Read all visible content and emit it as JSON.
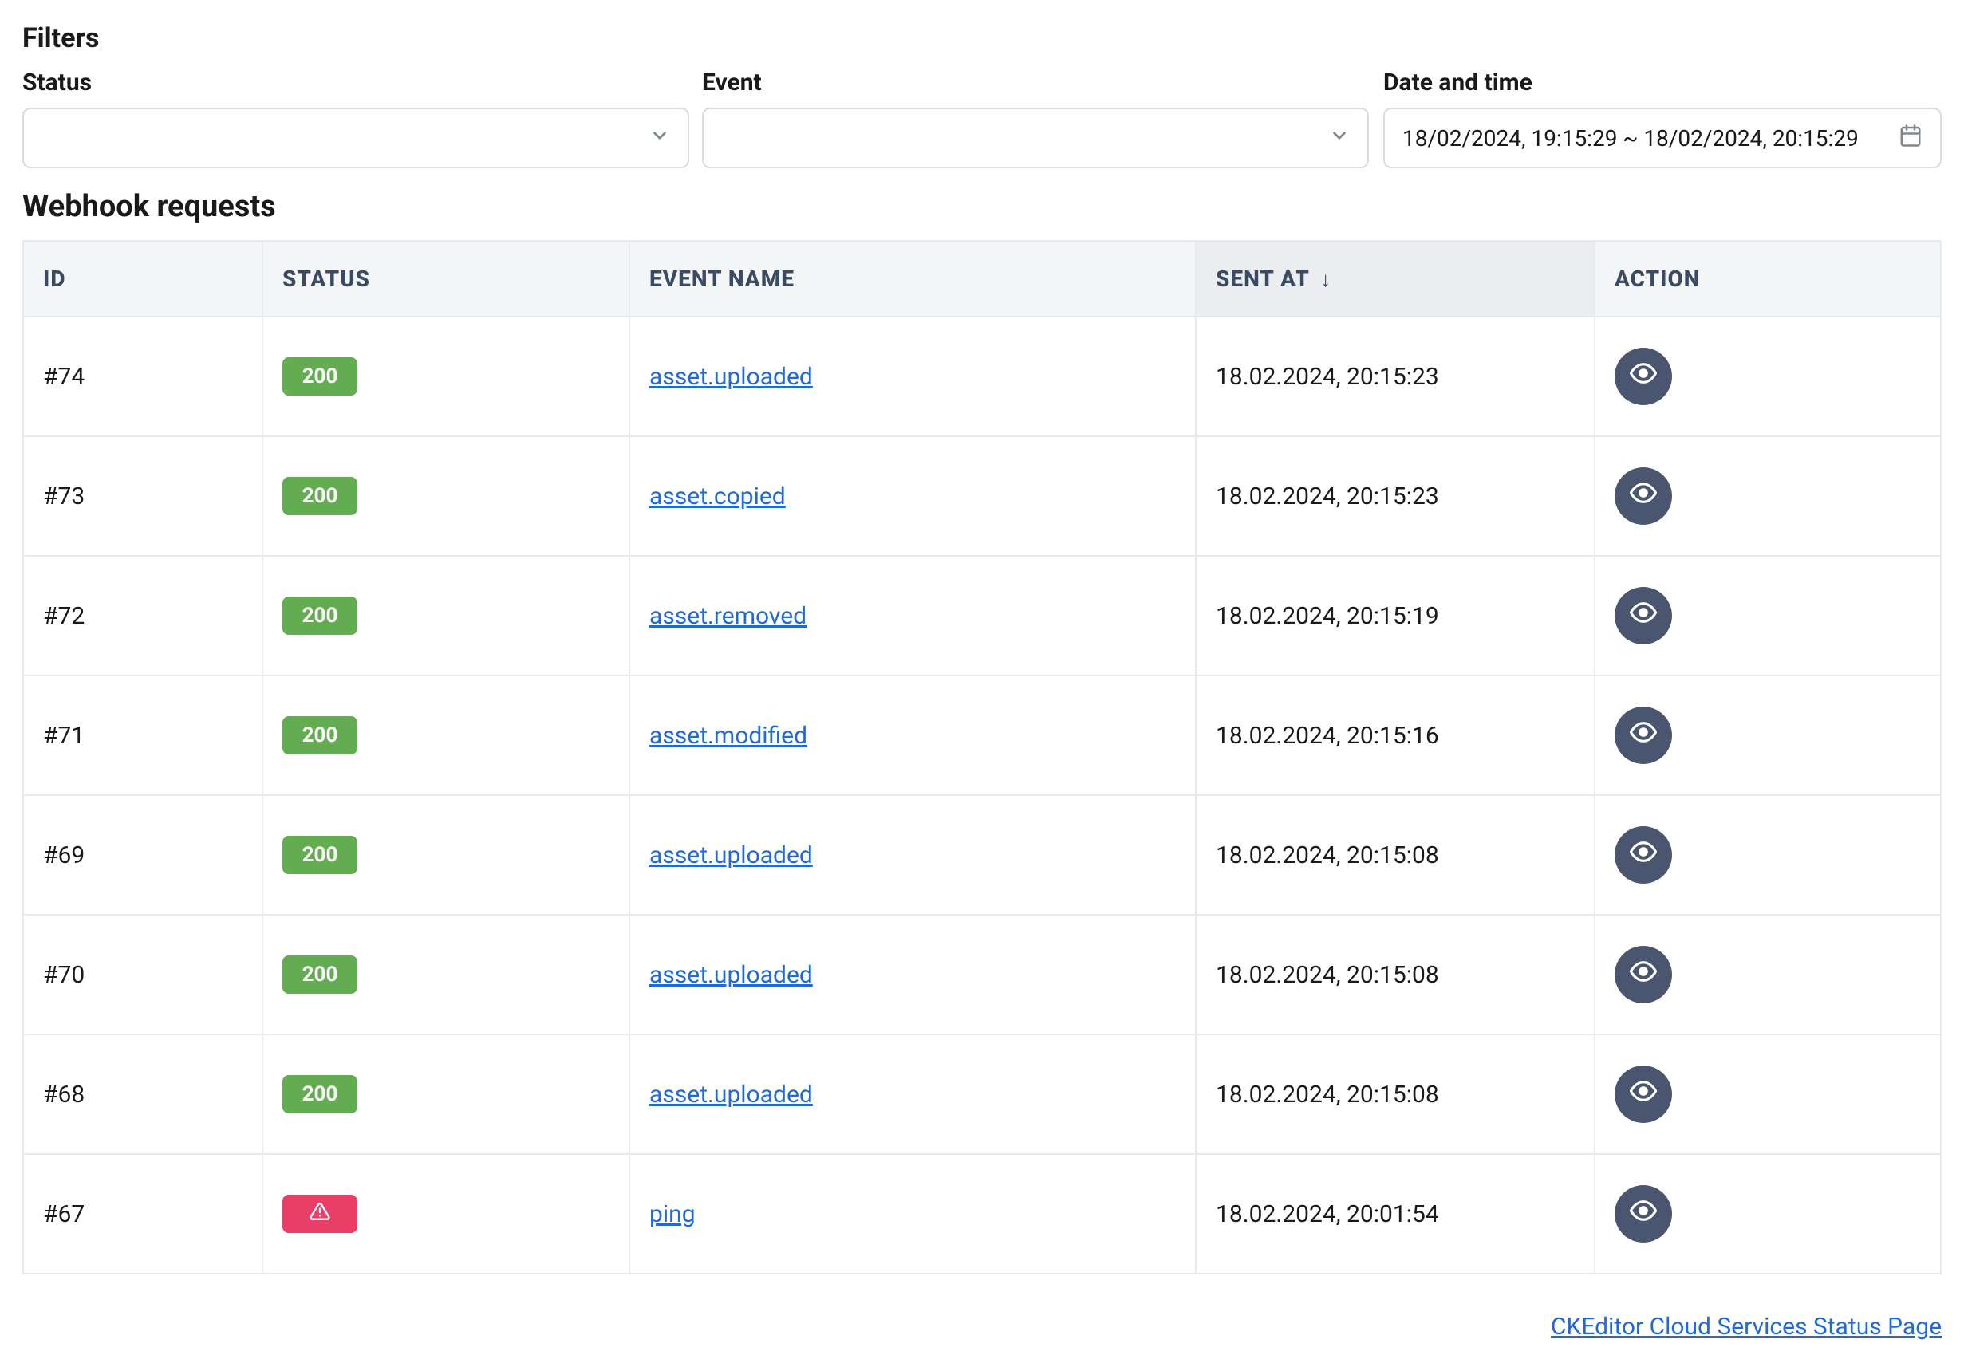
{
  "filters": {
    "heading": "Filters",
    "status": {
      "label": "Status",
      "value": ""
    },
    "event": {
      "label": "Event",
      "value": ""
    },
    "date": {
      "label": "Date and time",
      "value": "18/02/2024, 19:15:29 ~ 18/02/2024, 20:15:29"
    }
  },
  "requests": {
    "heading": "Webhook requests"
  },
  "table": {
    "columns": {
      "id": "ID",
      "status": "STATUS",
      "event": "EVENT NAME",
      "sent": "SENT AT",
      "action": "ACTION"
    },
    "rows": [
      {
        "id": "#74",
        "status_code": "200",
        "status_type": "success",
        "event": "asset.uploaded",
        "sent_at": "18.02.2024, 20:15:23"
      },
      {
        "id": "#73",
        "status_code": "200",
        "status_type": "success",
        "event": "asset.copied",
        "sent_at": "18.02.2024, 20:15:23"
      },
      {
        "id": "#72",
        "status_code": "200",
        "status_type": "success",
        "event": "asset.removed",
        "sent_at": "18.02.2024, 20:15:19"
      },
      {
        "id": "#71",
        "status_code": "200",
        "status_type": "success",
        "event": "asset.modified",
        "sent_at": "18.02.2024, 20:15:16"
      },
      {
        "id": "#69",
        "status_code": "200",
        "status_type": "success",
        "event": "asset.uploaded",
        "sent_at": "18.02.2024, 20:15:08"
      },
      {
        "id": "#70",
        "status_code": "200",
        "status_type": "success",
        "event": "asset.uploaded",
        "sent_at": "18.02.2024, 20:15:08"
      },
      {
        "id": "#68",
        "status_code": "200",
        "status_type": "success",
        "event": "asset.uploaded",
        "sent_at": "18.02.2024, 20:15:08"
      },
      {
        "id": "#67",
        "status_code": "",
        "status_type": "error",
        "event": "ping",
        "sent_at": "18.02.2024, 20:01:54"
      }
    ]
  },
  "footer": {
    "link_text": "CKEditor Cloud Services Status Page"
  }
}
